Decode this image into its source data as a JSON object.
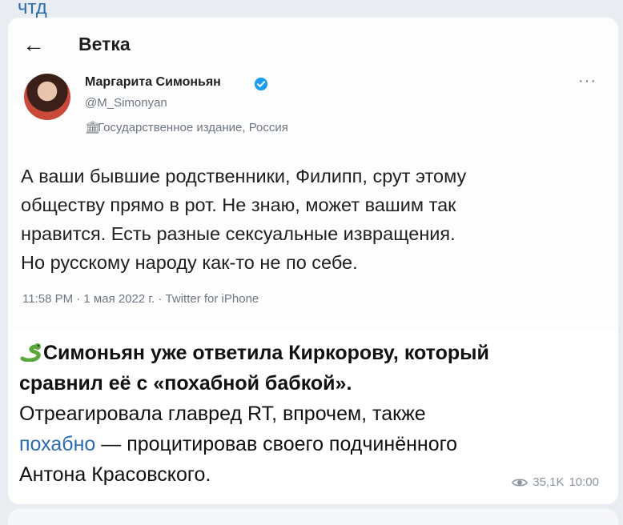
{
  "top_link": "чтд",
  "thread": {
    "title": "Ветка",
    "author_name": "Маргарита Симоньян",
    "handle": "@M_Simonyan",
    "affiliation": "Государственное издание, Россия",
    "text_lines": [
      "А ваши бывшие родственники, Филипп, срут этому",
      "обществу прямо в рот. Не знаю, может вашим так",
      "нравится. Есть разные сексуальные извращения.",
      "Но русскому народу как-то не по себе."
    ],
    "meta": "11:58 PM · 1 мая 2022 г. · Twitter for iPhone"
  },
  "post": {
    "bold_line_1": "Симоньян уже ответила Киркорову, который",
    "bold_line_2": "сравнил её с «похабной бабкой».",
    "line_3": "Отреагировала главред RT, впрочем, также",
    "link_text": "похабно",
    "line_4_rest": " — процитировав своего подчинённого",
    "line_5": "Антона Красовского.",
    "views": "35,1K",
    "time": "10:00"
  },
  "colors": {
    "link": "#2b6cb0",
    "verified": "#1d9bf0"
  }
}
